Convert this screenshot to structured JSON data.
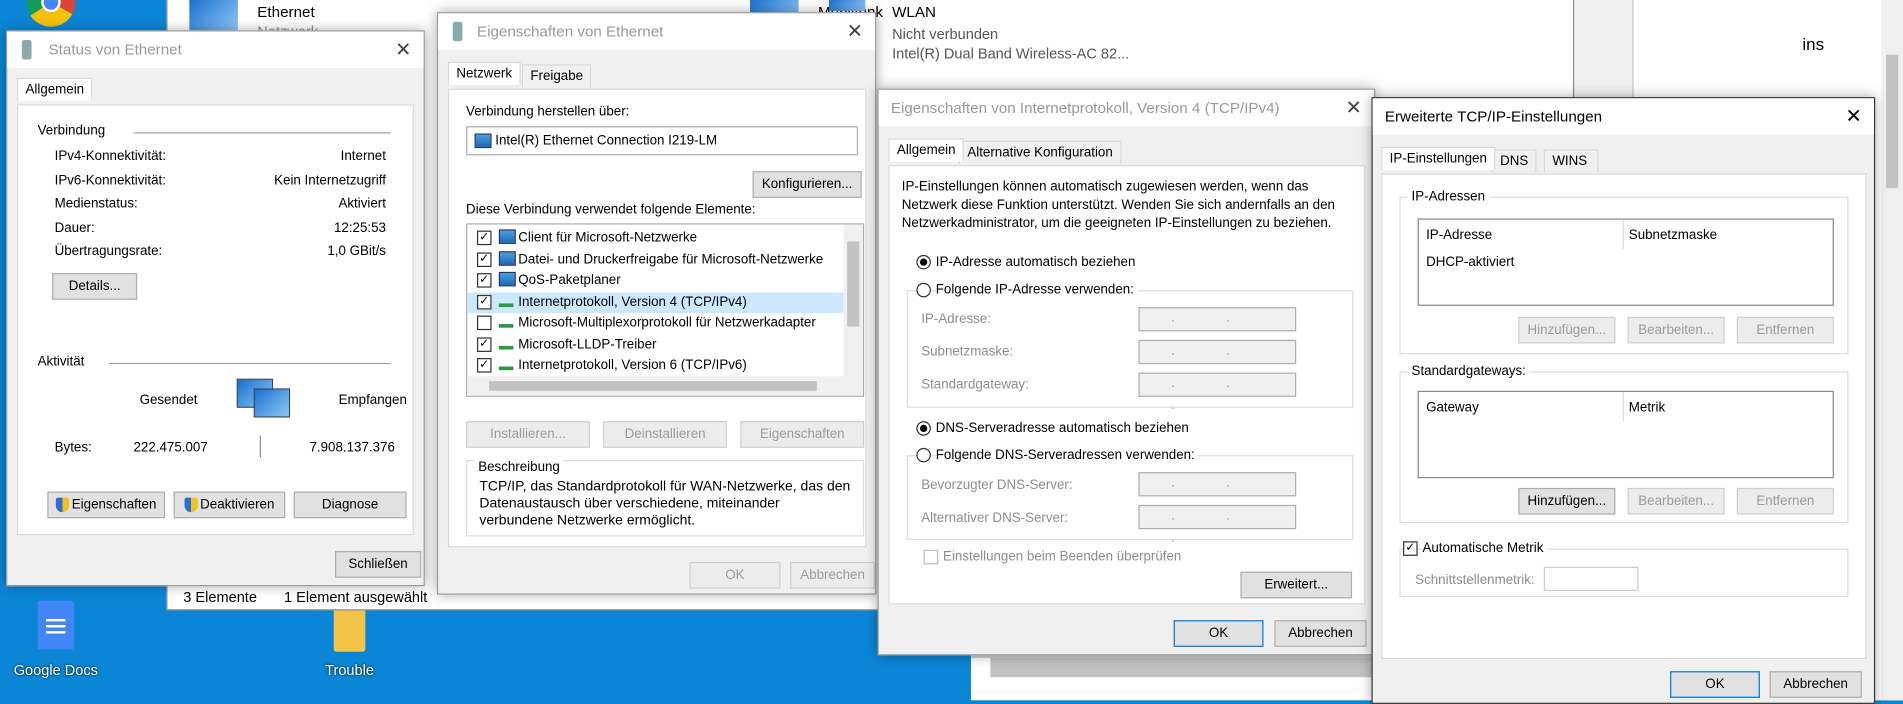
{
  "desktop": {
    "icons": [
      {
        "label": "Google Docs",
        "icon": "google-docs-icon"
      },
      {
        "label": "Trouble",
        "icon": "folder-icon"
      },
      {
        "label": "",
        "icon": "chrome-icon"
      }
    ]
  },
  "explorer": {
    "items": [
      {
        "name": "Ethernet",
        "status": "Netzwerk",
        "icon": "network-adapter-icon"
      },
      {
        "name": "Mobilfunk",
        "icon": "network-adapter-icon"
      },
      {
        "name": "WLAN",
        "status": "Nicht verbunden",
        "device": "Intel(R) Dual Band Wireless-AC 82...",
        "icon": "network-adapter-icon"
      }
    ],
    "status_count": "3 Elemente",
    "status_selected": "1 Element ausgewählt",
    "side_text": "ins"
  },
  "status_window": {
    "title": "Status von Ethernet",
    "tab": "Allgemein",
    "connection_label": "Verbindung",
    "rows": [
      {
        "label": "IPv4-Konnektivität:",
        "value": "Internet"
      },
      {
        "label": "IPv6-Konnektivität:",
        "value": "Kein Internetzugriff"
      },
      {
        "label": "Medienstatus:",
        "value": "Aktiviert"
      },
      {
        "label": "Dauer:",
        "value": "12:25:53"
      },
      {
        "label": "Übertragungsrate:",
        "value": "1,0 GBit/s"
      }
    ],
    "details": "Details...",
    "activity_label": "Aktivität",
    "sent": "Gesendet",
    "received": "Empfangen",
    "bytes_label": "Bytes:",
    "bytes_sent": "222.475.007",
    "bytes_received": "7.908.137.376",
    "properties": "Eigenschaften",
    "disable": "Deaktivieren",
    "diagnose": "Diagnose",
    "close": "Schließen"
  },
  "eth_props": {
    "title": "Eigenschaften von Ethernet",
    "tabs": [
      "Netzwerk",
      "Freigabe"
    ],
    "connect_using": "Verbindung herstellen über:",
    "adapter": "Intel(R) Ethernet Connection I219-LM",
    "configure": "Konfigurieren...",
    "items_label": "Diese Verbindung verwendet folgende Elemente:",
    "items": [
      {
        "label": "Client für Microsoft-Netzwerke",
        "checked": true
      },
      {
        "label": "Datei- und Druckerfreigabe für Microsoft-Netzwerke",
        "checked": true
      },
      {
        "label": "QoS-Paketplaner",
        "checked": true
      },
      {
        "label": "Internetprotokoll, Version 4 (TCP/IPv4)",
        "checked": true,
        "selected": true
      },
      {
        "label": "Microsoft-Multiplexorprotokoll für Netzwerkadapter",
        "checked": false
      },
      {
        "label": "Microsoft-LLDP-Treiber",
        "checked": true
      },
      {
        "label": "Internetprotokoll, Version 6 (TCP/IPv6)",
        "checked": true
      }
    ],
    "install": "Installieren...",
    "uninstall": "Deinstallieren",
    "properties": "Eigenschaften",
    "description_label": "Beschreibung",
    "description": "TCP/IP, das Standardprotokoll für WAN-Netzwerke, das den Datenaustausch über verschiedene, miteinander verbundene Netzwerke ermöglicht.",
    "ok": "OK",
    "cancel": "Abbrechen"
  },
  "ipv4": {
    "title": "Eigenschaften von Internetprotokoll, Version 4 (TCP/IPv4)",
    "tabs": [
      "Allgemein",
      "Alternative Konfiguration"
    ],
    "intro": "IP-Einstellungen können automatisch zugewiesen werden, wenn das Netzwerk diese Funktion unterstützt. Wenden Sie sich andernfalls an den Netzwerkadministrator, um die geeigneten IP-Einstellungen zu beziehen.",
    "ip_auto": "IP-Adresse automatisch beziehen",
    "ip_manual": "Folgende IP-Adresse verwenden:",
    "ip_address": "IP-Adresse:",
    "subnet": "Subnetzmaske:",
    "gateway": "Standardgateway:",
    "dns_auto": "DNS-Serveradresse automatisch beziehen",
    "dns_manual": "Folgende DNS-Serveradressen verwenden:",
    "dns_pref": "Bevorzugter DNS-Server:",
    "dns_alt": "Alternativer DNS-Server:",
    "ip_placeholder": ". . .",
    "validate": "Einstellungen beim Beenden überprüfen",
    "advanced": "Erweitert...",
    "ok": "OK",
    "cancel": "Abbrechen"
  },
  "advanced": {
    "title": "Erweiterte TCP/IP-Einstellungen",
    "tabs": [
      "IP-Einstellungen",
      "DNS",
      "WINS"
    ],
    "ip_group": "IP-Adressen",
    "col_ip": "IP-Adresse",
    "col_mask": "Subnetzmaske",
    "dhcp": "DHCP-aktiviert",
    "add": "Hinzufügen...",
    "edit": "Bearbeiten...",
    "remove": "Entfernen",
    "gw_group": "Standardgateways:",
    "col_gw": "Gateway",
    "col_metric": "Metrik",
    "auto_metric": "Automatische Metrik",
    "if_metric": "Schnittstellenmetrik:",
    "ok": "OK",
    "cancel": "Abbrechen"
  }
}
